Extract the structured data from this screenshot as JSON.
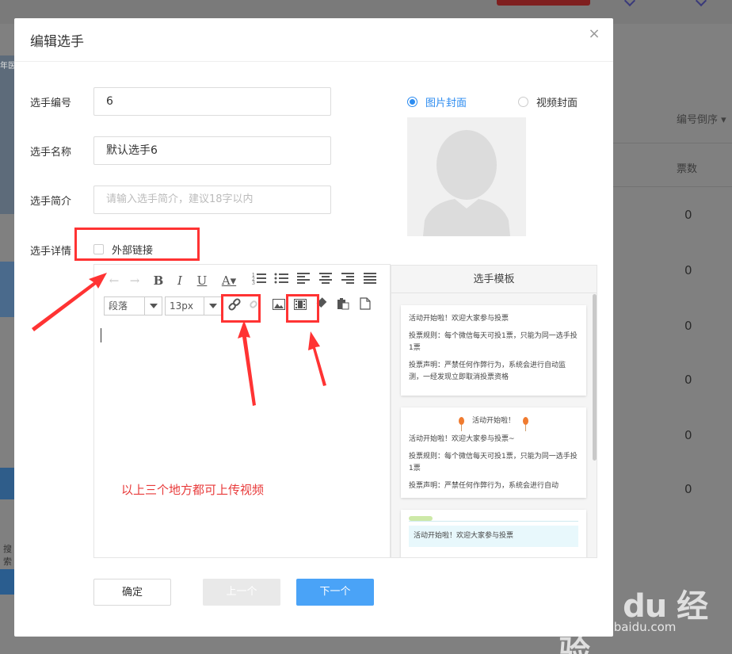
{
  "background": {
    "sort_label": "编号倒序",
    "votes_header": "票数",
    "vote_values": [
      "0",
      "0",
      "0",
      "0",
      "0",
      "0"
    ],
    "left_edge_text": "年医",
    "search_text": "搜索"
  },
  "modal": {
    "title": "编辑选手",
    "close_icon": "close-icon",
    "fields": {
      "number_label": "选手编号",
      "number_value": "6",
      "name_label": "选手名称",
      "name_value": "默认选手6",
      "intro_label": "选手简介",
      "intro_placeholder": "请输入选手简介，建议18字以内",
      "detail_label": "选手详情"
    },
    "cover": {
      "image_cover_label": "图片封面",
      "video_cover_label": "视频封面",
      "selected": "图片封面"
    },
    "external_link_label": "外部链接",
    "editor": {
      "paragraph_select": "段落",
      "font_size_select": "13px"
    },
    "templates": {
      "title": "选手模板",
      "card1": {
        "line1": "活动开始啦！欢迎大家参与投票",
        "line2": "投票规则：每个微信每天可投1票，只能为同一选手投1票",
        "line3": "投票声明：严禁任何作弊行为，系统会进行自动监测，一经发现立即取消投票资格"
      },
      "card2": {
        "heading": "活动开始啦！",
        "line1": "活动开始啦！欢迎大家参与投票~",
        "line2": "投票规则：每个微信每天可投1票，只能为同一选手投1票",
        "line3": "投票声明：严禁任何作弊行为，系统会进行自动"
      },
      "card3": {
        "line1": "活动开始啦！欢迎大家参与投票"
      }
    },
    "buttons": {
      "confirm": "确定",
      "prev": "上一个",
      "next": "下一个"
    }
  },
  "annotation": {
    "text": "以上三个地方都可上传视频",
    "color": "#f33333"
  },
  "watermark": {
    "main": "Bai du 经验",
    "sub": "jingyan.baidu.com"
  }
}
